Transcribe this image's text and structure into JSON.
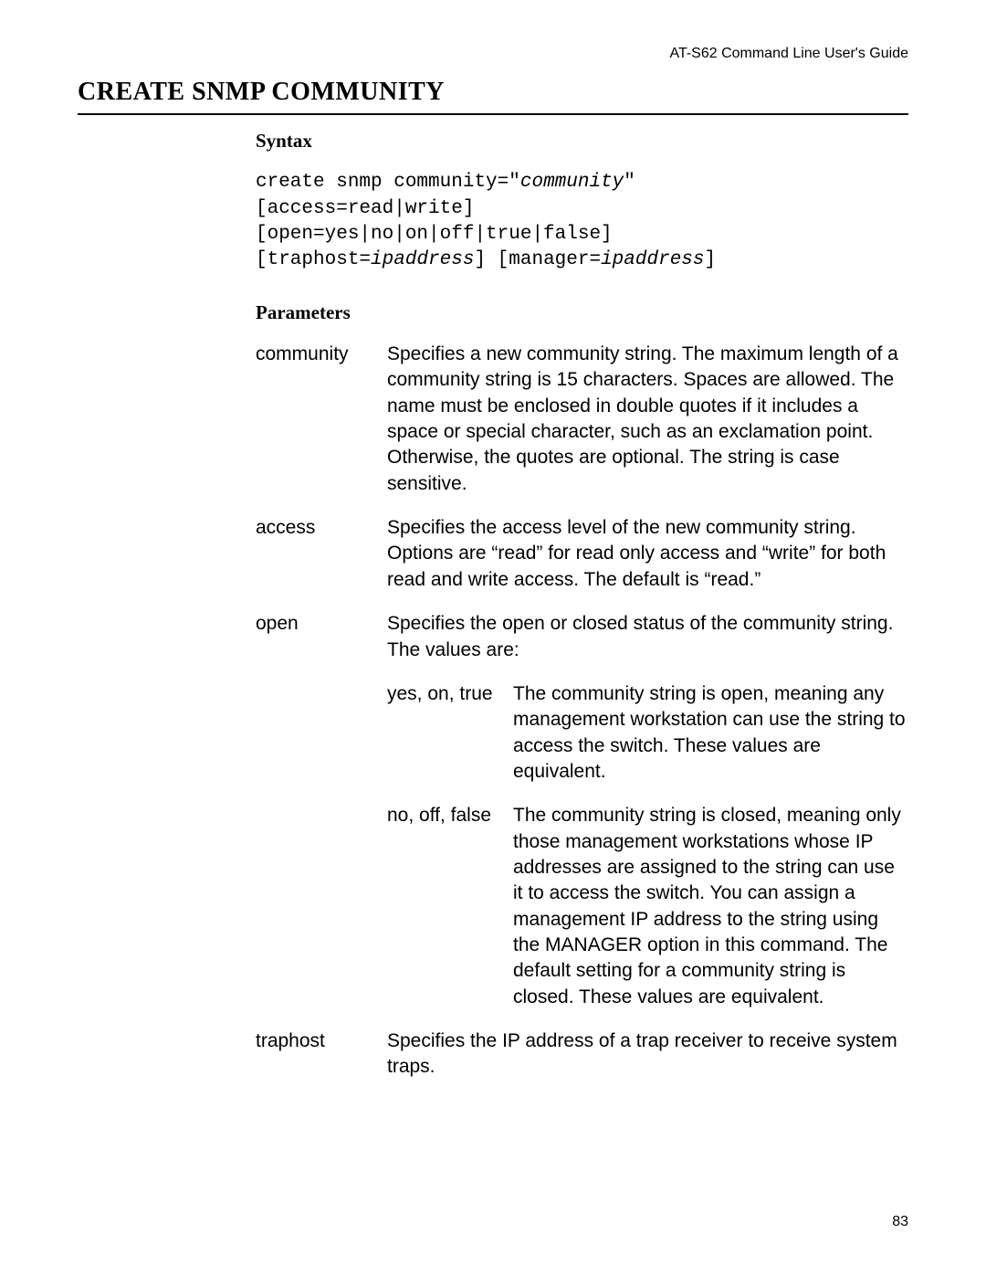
{
  "running_header": "AT-S62 Command Line User's Guide",
  "page_number": "83",
  "title": "CREATE SNMP COMMUNITY",
  "sections": {
    "syntax_label": "Syntax",
    "parameters_label": "Parameters"
  },
  "syntax": {
    "l1a": "create snmp community=\"",
    "l1b": "community",
    "l1c": "\"",
    "l2": "[access=read|write]",
    "l3": "[open=yes|no|on|off|true|false]",
    "l4a": "[traphost=",
    "l4b": "ipaddress",
    "l4c": "] [manager=",
    "l4d": "ipaddress",
    "l4e": "]"
  },
  "params": {
    "community": {
      "name": "community",
      "desc": "Specifies a new community string. The maximum length of a community string is 15 characters. Spaces are allowed. The name must be enclosed in double quotes if it includes a space or special character, such as an exclamation point. Otherwise, the quotes are optional. The string is case sensitive."
    },
    "access": {
      "name": "access",
      "desc": "Specifies the access level of the new community string. Options are “read” for read only access and “write” for both read and write access. The default is “read.”"
    },
    "open": {
      "name": "open",
      "desc": "Specifies the open or closed status of the community string. The values are:",
      "values": {
        "yes": {
          "label": "yes, on, true",
          "desc": "The community string is open, meaning any management workstation can use the string to access the switch. These values are equivalent."
        },
        "no": {
          "label": "no, off, false",
          "desc": "The community string is closed, meaning only those management workstations whose IP addresses are assigned to the string can use it to access the switch. You can assign a management IP address to the string using the MANAGER option in this command. The default setting for a community string is closed. These values are equivalent."
        }
      }
    },
    "traphost": {
      "name": "traphost",
      "desc": "Specifies the IP address of a trap receiver to receive system traps."
    }
  }
}
